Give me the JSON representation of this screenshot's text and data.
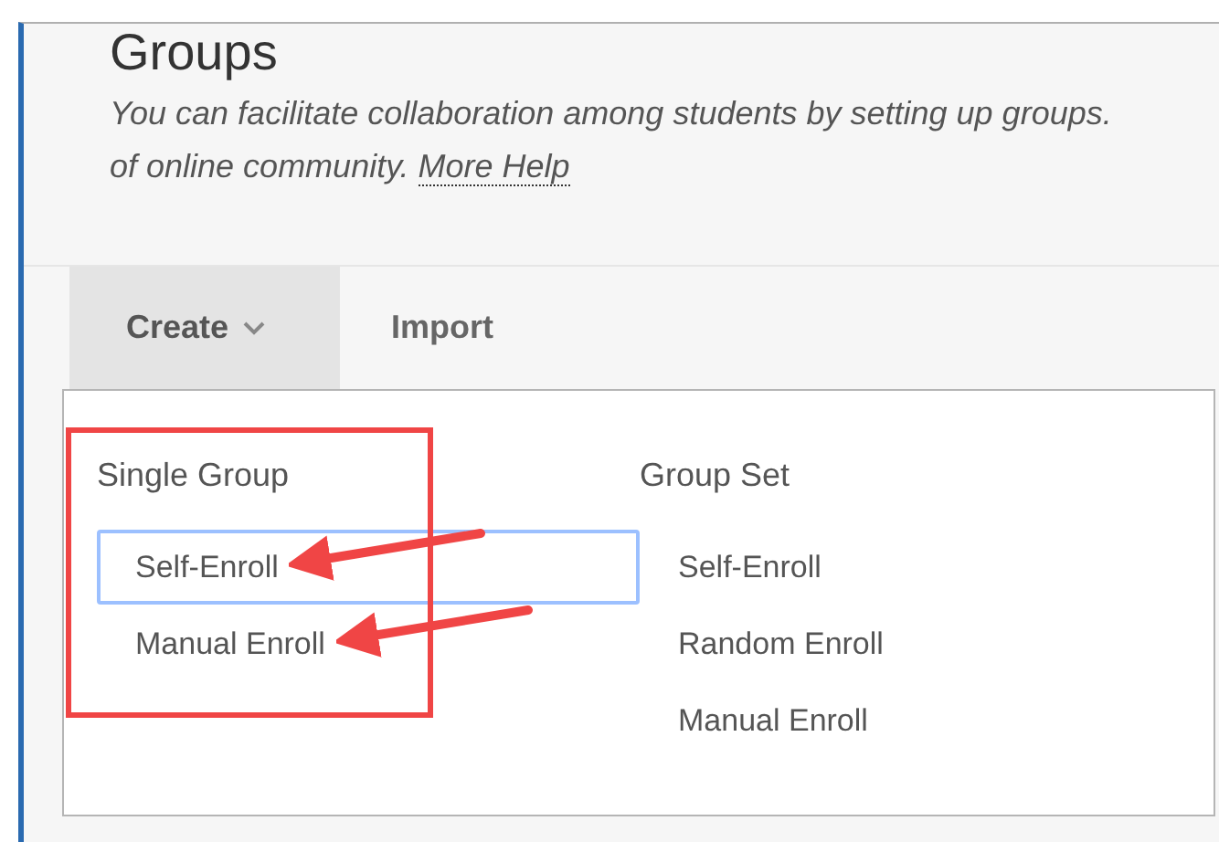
{
  "page": {
    "title": "Groups",
    "description": [
      "You can facilitate collaboration among students by setting up groups.",
      "of online community."
    ],
    "help_link": "More Help"
  },
  "toolbar": [
    {
      "label": "Create",
      "selected": true,
      "kind": "dropdown"
    },
    {
      "label": "Import",
      "selected": false,
      "kind": "plain"
    }
  ],
  "menu": {
    "columns": [
      {
        "heading": "Single Group",
        "highlighted": true,
        "items": [
          {
            "label": "Self-Enroll",
            "focused": true,
            "arrow": true
          },
          {
            "label": "Manual Enroll",
            "focused": false,
            "arrow": true
          }
        ]
      },
      {
        "heading": "Group Set",
        "highlighted": false,
        "items": [
          {
            "label": "Self-Enroll",
            "focused": false,
            "arrow": false
          },
          {
            "label": "Random Enroll",
            "focused": false,
            "arrow": false
          },
          {
            "label": "Manual Enroll",
            "focused": false,
            "arrow": false
          }
        ]
      }
    ]
  }
}
